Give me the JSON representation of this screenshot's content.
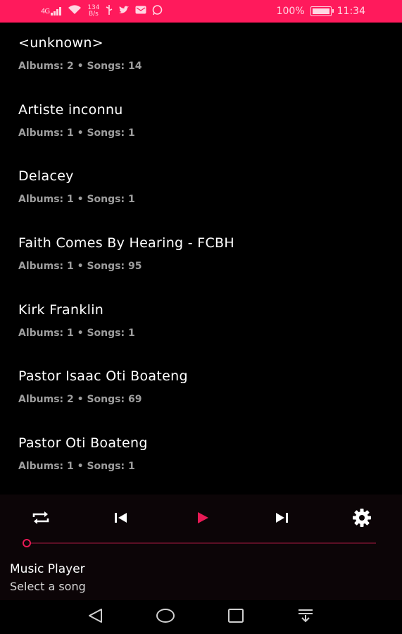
{
  "status_bar": {
    "signal": "4G",
    "speed_value": "134",
    "speed_unit": "B/s",
    "battery_text": "100%",
    "time": "11:34",
    "icons": [
      "signal-icon",
      "wifi-icon",
      "usb-icon",
      "twitter-icon",
      "mail-icon",
      "whatsapp-icon",
      "battery-icon"
    ]
  },
  "artists": [
    {
      "name": "<unknown>",
      "meta": "Albums: 2 • Songs: 14"
    },
    {
      "name": "Artiste inconnu",
      "meta": "Albums: 1 • Songs: 1"
    },
    {
      "name": "Delacey",
      "meta": "Albums: 1 • Songs: 1"
    },
    {
      "name": "Faith Comes By Hearing - FCBH",
      "meta": "Albums: 1 • Songs: 95"
    },
    {
      "name": "Kirk Franklin",
      "meta": "Albums: 1 • Songs: 1"
    },
    {
      "name": "Pastor Isaac Oti Boateng",
      "meta": "Albums: 2 • Songs: 69"
    },
    {
      "name": "Pastor Oti Boateng",
      "meta": "Albums: 1 • Songs: 1"
    }
  ],
  "player": {
    "title": "Music Player",
    "subtitle": "Select a song",
    "progress": 0,
    "accent_color": "#e81a55",
    "controls": [
      "repeat-icon",
      "previous-icon",
      "play-icon",
      "next-icon",
      "settings-icon"
    ]
  },
  "nav_bar": {
    "buttons": [
      "back-icon",
      "home-icon",
      "recents-icon",
      "notification-pull-icon"
    ]
  },
  "colors": {
    "status_bar": "#ff1a5c",
    "background": "#000000",
    "accent": "#e81a55"
  }
}
